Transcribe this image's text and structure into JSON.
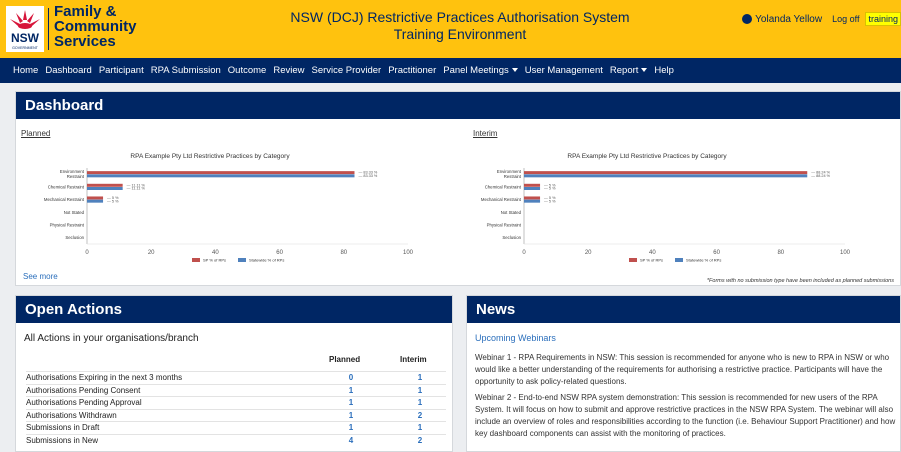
{
  "header": {
    "org_line1": "Family &",
    "org_line2": "Community",
    "org_line3": "Services",
    "logo_text": "NSW",
    "logo_sub": "GOVERNMENT",
    "system_title_line1": "NSW (DCJ) Restrictive Practices Authorisation System",
    "system_title_line2": "Training Environment",
    "user_name": "Yolanda Yellow",
    "logoff": "Log off",
    "environment_badge": "training"
  },
  "nav": {
    "items": [
      "Home",
      "Dashboard",
      "Participant",
      "RPA Submission",
      "Outcome",
      "Review",
      "Service Provider",
      "Practitioner",
      "Panel Meetings",
      "User Management",
      "Report",
      "Help"
    ]
  },
  "dashboard": {
    "title": "Dashboard",
    "planned_label": "Planned",
    "interim_label": "Interim",
    "see_more": "See more",
    "footnote": "*Forms with no submission type have been included as planned submissions"
  },
  "chart_data": [
    {
      "type": "bar",
      "orientation": "horizontal",
      "title": "RPA Example Pty Ltd Restrictive Practices by Category",
      "categories": [
        "Environment Restraint",
        "Chemical Restraint",
        "Mechanical Restraint",
        "Not Stated",
        "Physical Restraint",
        "Seclusion"
      ],
      "series": [
        {
          "name": "SP % of RPs",
          "values": [
            83.33,
            11.11,
            5,
            0,
            0,
            0
          ],
          "labels": [
            "83.33 %",
            "11.11 %",
            "5 %",
            "",
            "",
            ""
          ],
          "color": "#c0504d"
        },
        {
          "name": "Statewide % of RPs",
          "values": [
            83.33,
            11.11,
            5,
            0,
            0,
            0
          ],
          "labels": [
            "83.33 %",
            "11.11 %",
            "5 %",
            "",
            "",
            ""
          ],
          "color": "#4f81bd"
        }
      ],
      "xlim": [
        0,
        100
      ],
      "xticks": [
        "0",
        "20",
        "40",
        "60",
        "80",
        "100"
      ],
      "legend": "bottom"
    },
    {
      "type": "bar",
      "orientation": "horizontal",
      "title": "RPA Example Pty Ltd Restrictive Practices by Category",
      "categories": [
        "Environment Restraint",
        "Chemical Restraint",
        "Mechanical Restraint",
        "Not Stated",
        "Physical Restraint",
        "Seclusion"
      ],
      "series": [
        {
          "name": "SP % of RPs",
          "values": [
            88.24,
            5,
            5,
            0,
            0,
            0
          ],
          "labels": [
            "88.24 %",
            "5 %",
            "5 %",
            "",
            "",
            ""
          ],
          "color": "#c0504d"
        },
        {
          "name": "Statewide % of RPs",
          "values": [
            88.24,
            5,
            5,
            0,
            0,
            0
          ],
          "labels": [
            "88.24 %",
            "5 %",
            "5 %",
            "",
            "",
            ""
          ],
          "color": "#4f81bd"
        }
      ],
      "xlim": [
        0,
        100
      ],
      "xticks": [
        "0",
        "20",
        "40",
        "60",
        "80",
        "100"
      ],
      "legend": "bottom"
    }
  ],
  "open_actions": {
    "title": "Open Actions",
    "subtitle": "All Actions in your organisations/branch",
    "col_planned": "Planned",
    "col_interim": "Interim",
    "rows": [
      {
        "label": "Authorisations Expiring in the next 3 months",
        "planned": "0",
        "interim": "1"
      },
      {
        "label": "Authorisations Pending Consent",
        "planned": "1",
        "interim": "1"
      },
      {
        "label": "Authorisations Pending Approval",
        "planned": "1",
        "interim": "1"
      },
      {
        "label": "Authorisations Withdrawn",
        "planned": "1",
        "interim": "2"
      },
      {
        "label": "Submissions in Draft",
        "planned": "1",
        "interim": "1"
      },
      {
        "label": "Submissions in New",
        "planned": "4",
        "interim": "2"
      }
    ]
  },
  "news": {
    "title": "News",
    "subtitle": "Upcoming Webinars",
    "para1": "Webinar 1 - RPA Requirements in NSW: This session is recommended for anyone who is new to RPA in NSW or who would like a better understanding of the requirements for authorising a restrictive practice. Participants will have the opportunity to ask policy-related questions.",
    "para2": "Webinar 2 - End-to-end NSW RPA system demonstration: This session is recommended for new users of the RPA System. It will focus on how to submit and approve restrictive practices in the NSW RPA System. The webinar will also include an overview of roles and responsibilities according to the function (i.e. Behaviour Support Practitioner) and how key dashboard components can assist with the monitoring of practices."
  },
  "colors": {
    "header_bg": "#ffc20e",
    "nav_bg": "#002664",
    "link": "#2a6ebb"
  }
}
